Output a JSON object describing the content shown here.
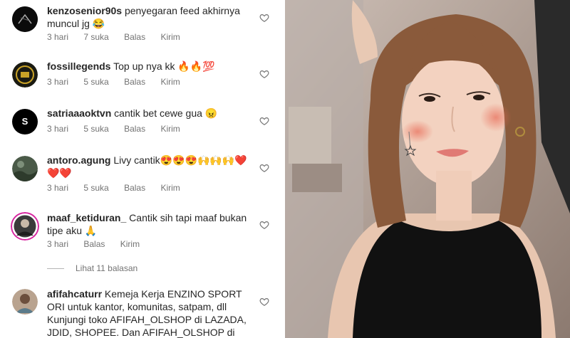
{
  "comments": [
    {
      "username": "kenzosenior90s",
      "text": "penyegaran feed akhirnya muncul jg 😂",
      "time": "3 hari",
      "likes": "7 suka",
      "reply": "Balas",
      "send": "Kirim"
    },
    {
      "username": "fossillegends",
      "text": "Top up nya kk 🔥🔥💯",
      "time": "3 hari",
      "likes": "5 suka",
      "reply": "Balas",
      "send": "Kirim"
    },
    {
      "username": "satriaaaoktvn",
      "text": "cantik bet cewe gua 😠",
      "time": "3 hari",
      "likes": "5 suka",
      "reply": "Balas",
      "send": "Kirim",
      "avatar_letter": "S"
    },
    {
      "username": "antoro.agung",
      "text": "Livy cantik😍😍😍🙌🙌🙌❤️❤️❤️",
      "time": "3 hari",
      "likes": "5 suka",
      "reply": "Balas",
      "send": "Kirim"
    },
    {
      "username": "maaf_ketiduran_",
      "text": "Cantik sih tapi maaf bukan tipe aku 🙏",
      "time": "3 hari",
      "reply": "Balas",
      "send": "Kirim"
    },
    {
      "username": "afifahcaturr",
      "text": "Kemeja Kerja ENZINO SPORT ORI untuk kantor, komunitas, satpam, dll Kunjungi toko AFIFAH_OLSHOP di LAZADA, JDID, SHOPEE. Dan AFIFAH_OLSHOP di TOKOPEDIA 😊"
    }
  ],
  "view_replies": "Lihat 11 balasan",
  "icons": {
    "like": "heart-icon"
  },
  "colors": {
    "text": "#262626",
    "secondary": "#737373",
    "story_ring": "#d6249f"
  }
}
